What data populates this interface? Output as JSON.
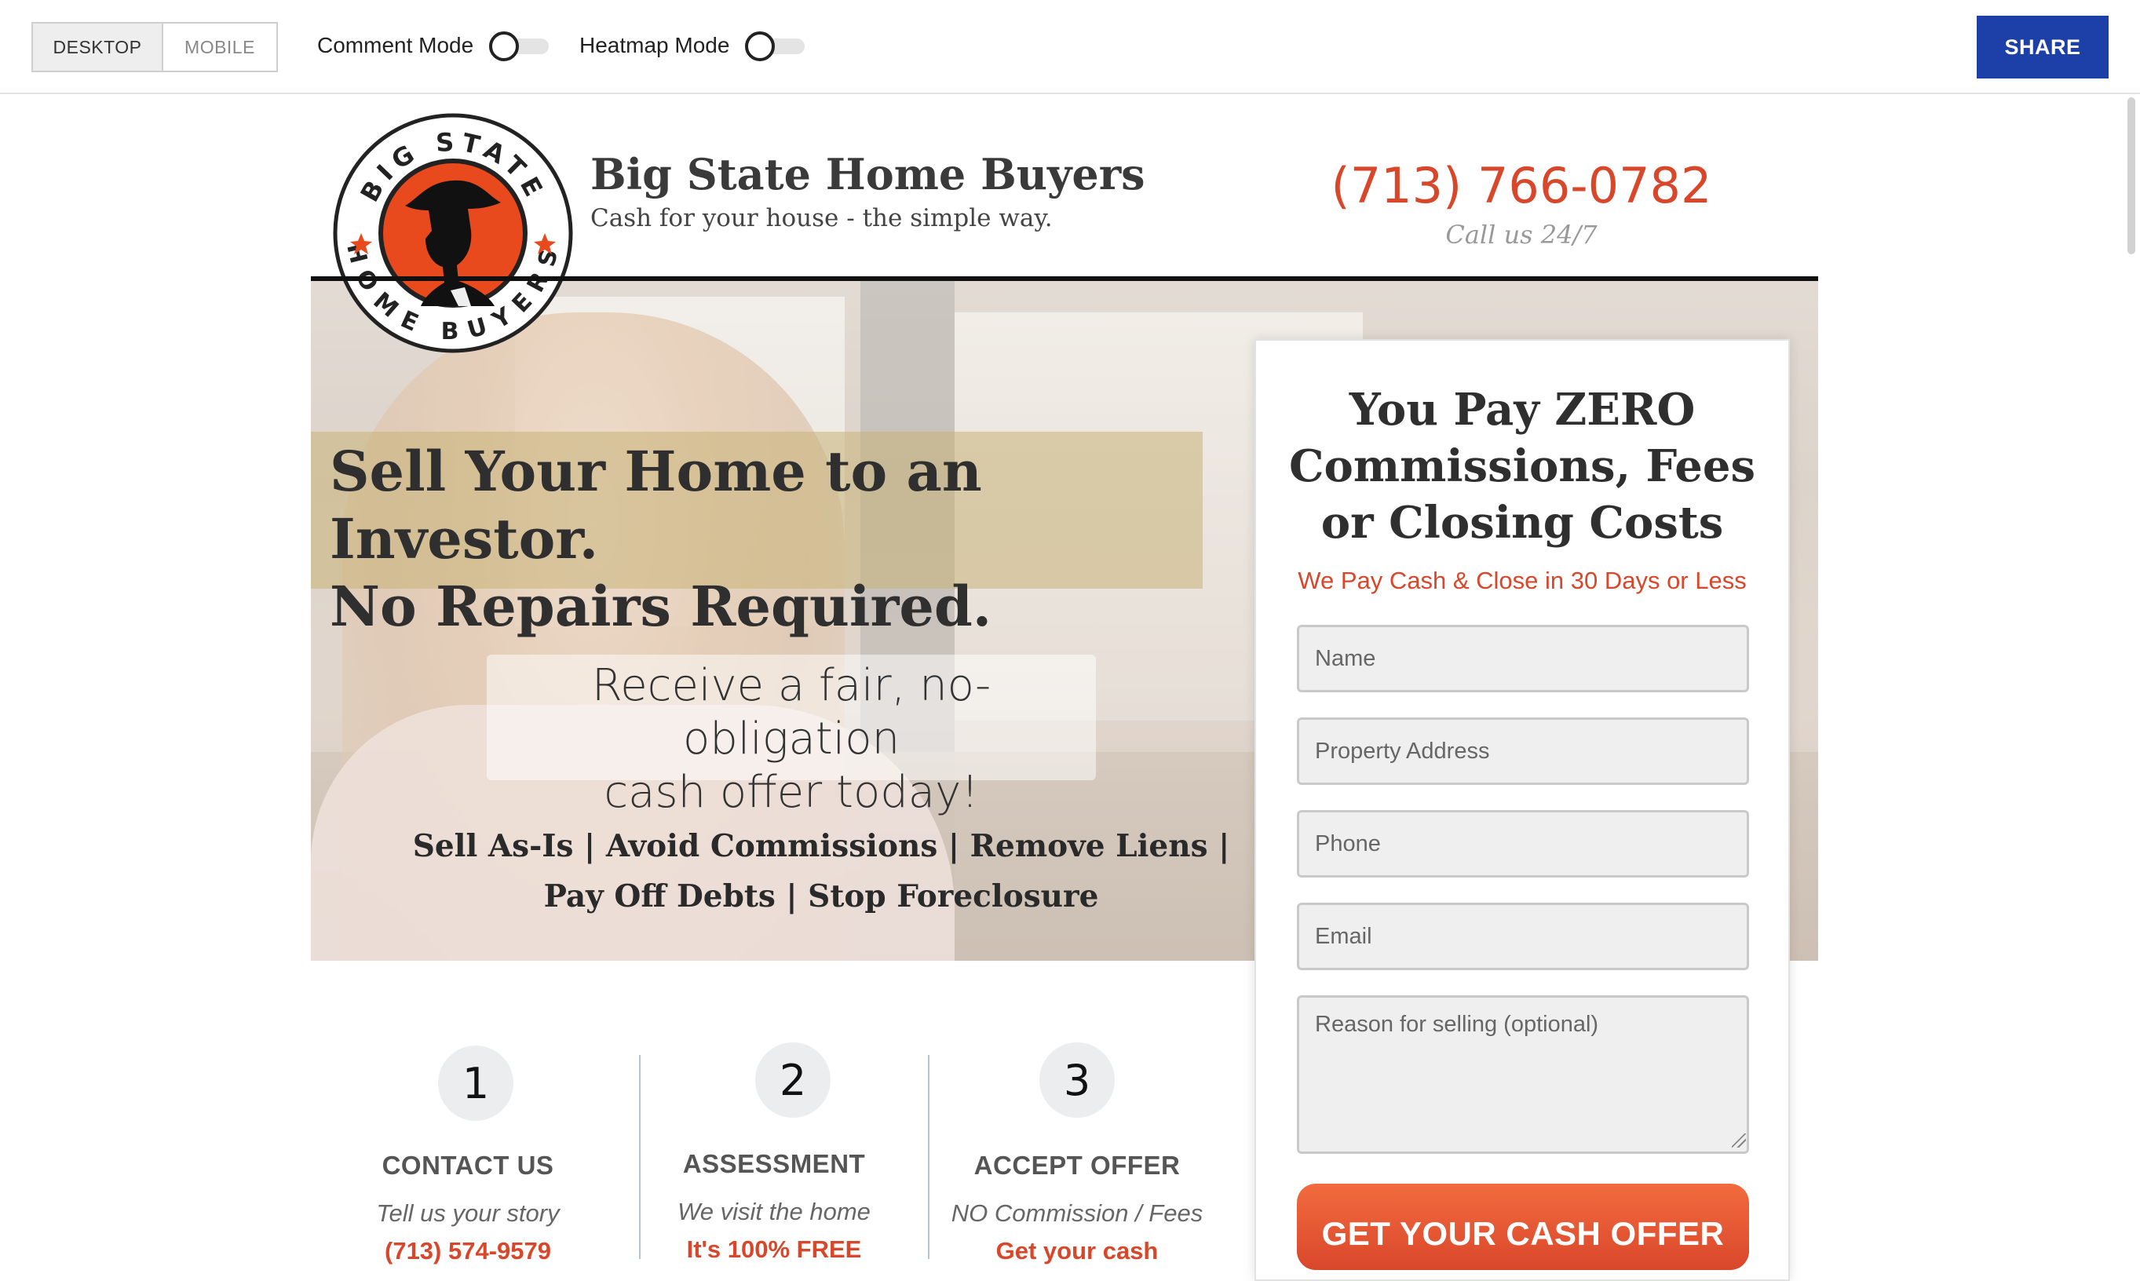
{
  "toolbar": {
    "view_desktop": "DESKTOP",
    "view_mobile": "MOBILE",
    "comment_mode": "Comment Mode",
    "heatmap_mode": "Heatmap Mode",
    "share": "SHARE"
  },
  "header": {
    "logo_top": "BIG STATE",
    "logo_bottom": "HOME BUYERS",
    "title": "Big State Home Buyers",
    "tagline": "Cash for your house - the simple way.",
    "phone": "(713) 766-0782",
    "call_note": "Call us 24/7"
  },
  "hero": {
    "headline_line1": "Sell Your Home to an Investor.",
    "headline_line2": "No Repairs Required.",
    "offer_line1": "Receive a fair, no-obligation",
    "offer_line2": "cash offer today!",
    "benefits_line1": "Sell As-Is | Avoid Commissions | Remove Liens |",
    "benefits_line2": "Pay Off Debts | Stop Foreclosure"
  },
  "form": {
    "title_line1": "You Pay ZERO",
    "title_line2": "Commissions, Fees",
    "title_line3": "or Closing Costs",
    "subtitle": "We Pay Cash & Close in 30 Days or Less",
    "name_placeholder": "Name",
    "address_placeholder": "Property Address",
    "phone_placeholder": "Phone",
    "email_placeholder": "Email",
    "reason_placeholder": "Reason for selling (optional)",
    "submit": "GET YOUR CASH OFFER"
  },
  "steps": [
    {
      "number": "1",
      "title": "CONTACT US",
      "desc": "Tell us your story",
      "extra": "(713) 574-9579"
    },
    {
      "number": "2",
      "title": "ASSESSMENT",
      "desc": "We visit the home",
      "extra": "It's 100% FREE"
    },
    {
      "number": "3",
      "title": "ACCEPT OFFER",
      "desc": "NO Commission / Fees",
      "extra": "Get your cash"
    }
  ],
  "colors": {
    "accent": "#d9472b",
    "share_button": "#1c3fa8"
  }
}
